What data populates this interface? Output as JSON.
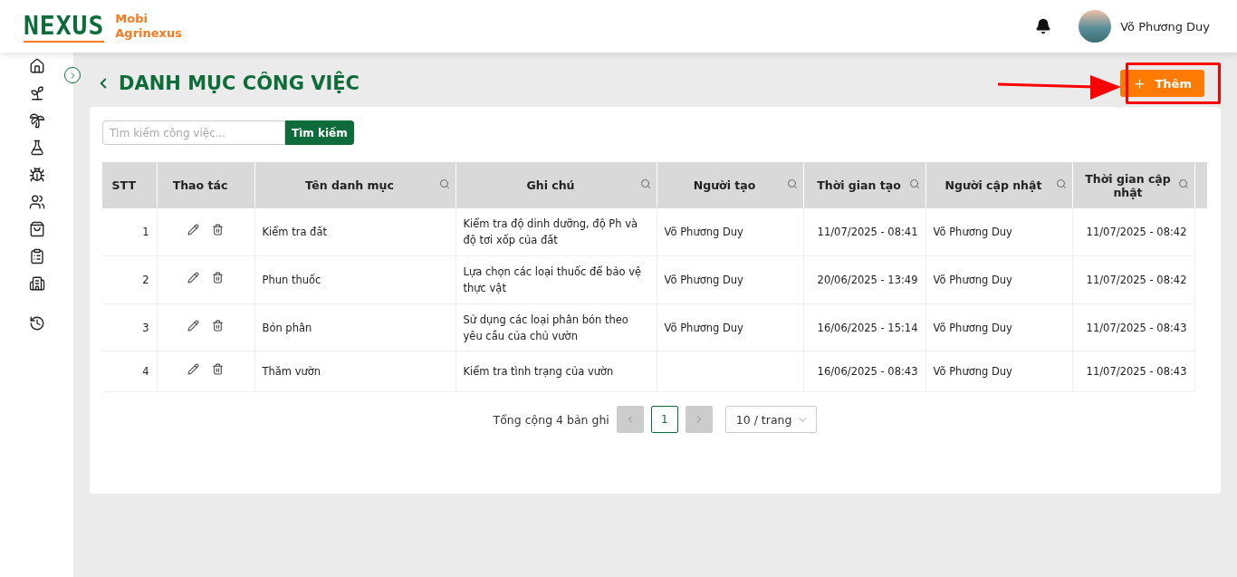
{
  "brand": {
    "logo": "NEXUS",
    "line1": "Mobi",
    "line2": "Agrinexus"
  },
  "user": {
    "name": "Võ Phương Duy"
  },
  "page": {
    "title": "DANH MỤC CÔNG VIỆC",
    "add_button": "Thêm"
  },
  "search": {
    "placeholder": "Tìm kiếm công việc...",
    "button": "Tìm kiếm"
  },
  "table": {
    "columns": [
      {
        "label": "STT",
        "filterable": false
      },
      {
        "label": "Thao tác",
        "filterable": false
      },
      {
        "label": "Tên danh mục",
        "filterable": true
      },
      {
        "label": "Ghi chú",
        "filterable": true
      },
      {
        "label": "Người tạo",
        "filterable": true
      },
      {
        "label": "Thời gian tạo",
        "filterable": true
      },
      {
        "label": "Người cập nhật",
        "filterable": true
      },
      {
        "label": "Thời gian cập nhật",
        "filterable": true
      }
    ],
    "rows": [
      {
        "stt": "1",
        "name": "Kiểm tra đất",
        "note": "Kiểm tra độ dinh dưỡng, độ Ph và độ tơi xốp của đất",
        "creator": "Võ Phương Duy",
        "created": "11/07/2025 - 08:41",
        "updater": "Võ Phương Duy",
        "updated": "11/07/2025 - 08:42"
      },
      {
        "stt": "2",
        "name": "Phun thuốc",
        "note": "Lựa chọn các loại thuốc để bảo vệ thực vật",
        "creator": "Võ Phương Duy",
        "created": "20/06/2025 - 13:49",
        "updater": "Võ Phương Duy",
        "updated": "11/07/2025 - 08:42"
      },
      {
        "stt": "3",
        "name": "Bón phân",
        "note": "Sử dụng các loại phân bón theo yêu cầu của chủ vườn",
        "creator": "Võ Phương Duy",
        "created": "16/06/2025 - 15:14",
        "updater": "Võ Phương Duy",
        "updated": "11/07/2025 - 08:43"
      },
      {
        "stt": "4",
        "name": "Thăm vườn",
        "note": "Kiểm tra tình trạng của vườn",
        "created": "16/06/2025 - 08:43",
        "updater": "Võ Phương Duy",
        "updated": "11/07/2025 - 08:43"
      }
    ]
  },
  "pagination": {
    "total": "Tổng cộng 4 bản ghi",
    "prev_disabled": true,
    "next_disabled": true,
    "pages": [
      {
        "label": "1",
        "selected": true
      }
    ],
    "page_size": "10 / trang"
  }
}
